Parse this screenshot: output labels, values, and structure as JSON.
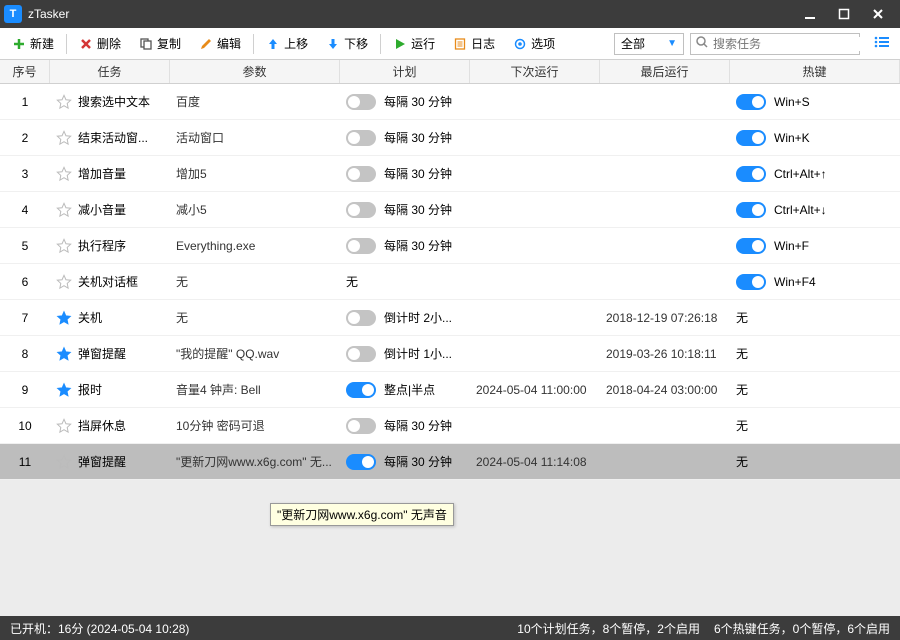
{
  "app": {
    "title": "zTasker"
  },
  "toolbar": {
    "new": "新建",
    "delete": "删除",
    "copy": "复制",
    "edit": "编辑",
    "up": "上移",
    "down": "下移",
    "run": "运行",
    "log": "日志",
    "options": "选项",
    "filter": "全部",
    "search_ph": "搜索任务"
  },
  "columns": {
    "idx": "序号",
    "task": "任务",
    "param": "参数",
    "plan": "计划",
    "next": "下次运行",
    "last": "最后运行",
    "hotkey": "热键"
  },
  "rows": [
    {
      "idx": "1",
      "star": false,
      "task": "搜索选中文本",
      "param": "百度",
      "plan_on": false,
      "plan": "每隔 30 分钟",
      "next": "",
      "last": "",
      "hk_on": true,
      "hotkey": "Win+S"
    },
    {
      "idx": "2",
      "star": false,
      "task": "结束活动窗...",
      "param": "活动窗口",
      "plan_on": false,
      "plan": "每隔 30 分钟",
      "next": "",
      "last": "",
      "hk_on": true,
      "hotkey": "Win+K"
    },
    {
      "idx": "3",
      "star": false,
      "task": "增加音量",
      "param": "增加5",
      "plan_on": false,
      "plan": "每隔 30 分钟",
      "next": "",
      "last": "",
      "hk_on": true,
      "hotkey": "Ctrl+Alt+↑"
    },
    {
      "idx": "4",
      "star": false,
      "task": "减小音量",
      "param": "减小5",
      "plan_on": false,
      "plan": "每隔 30 分钟",
      "next": "",
      "last": "",
      "hk_on": true,
      "hotkey": "Ctrl+Alt+↓"
    },
    {
      "idx": "5",
      "star": false,
      "task": "执行程序",
      "param": "Everything.exe",
      "plan_on": false,
      "plan": "每隔 30 分钟",
      "next": "",
      "last": "",
      "hk_on": true,
      "hotkey": "Win+F"
    },
    {
      "idx": "6",
      "star": false,
      "task": "关机对话框",
      "param": "无",
      "plan_on": null,
      "plan": "无",
      "next": "",
      "last": "",
      "hk_on": true,
      "hotkey": "Win+F4"
    },
    {
      "idx": "7",
      "star": true,
      "task": "关机",
      "param": "无",
      "plan_on": false,
      "plan": "倒计时 2小...",
      "next": "",
      "last": "2018-12-19 07:26:18",
      "hk_on": null,
      "hotkey": "无"
    },
    {
      "idx": "8",
      "star": true,
      "task": "弹窗提醒",
      "param": "\"我的提醒\" QQ.wav",
      "plan_on": false,
      "plan": "倒计时 1小...",
      "next": "",
      "last": "2019-03-26 10:18:11",
      "hk_on": null,
      "hotkey": "无"
    },
    {
      "idx": "9",
      "star": true,
      "task": "报时",
      "param": "音量4 钟声: Bell",
      "plan_on": true,
      "plan": "整点|半点",
      "next": "2024-05-04 11:00:00",
      "last": "2018-04-24 03:00:00",
      "hk_on": null,
      "hotkey": "无"
    },
    {
      "idx": "10",
      "star": false,
      "task": "挡屏休息",
      "param": "10分钟 密码可退",
      "plan_on": false,
      "plan": "每隔 30 分钟",
      "next": "",
      "last": "",
      "hk_on": null,
      "hotkey": "无"
    },
    {
      "idx": "11",
      "star": false,
      "task": "弹窗提醒",
      "param": "\"更新刀网www.x6g.com\" 无...",
      "plan_on": true,
      "plan": "每隔 30 分钟",
      "next": "2024-05-04 11:14:08",
      "last": "",
      "hk_on": null,
      "hotkey": "无",
      "sel": true
    }
  ],
  "tooltip": "\"更新刀网www.x6g.com\" 无声音",
  "status": {
    "left": "已开机：16分 (2024-05-04 10:28)",
    "r1": "10个计划任务，8个暂停，2个启用",
    "r2": "6个热键任务，0个暂停，6个启用"
  }
}
